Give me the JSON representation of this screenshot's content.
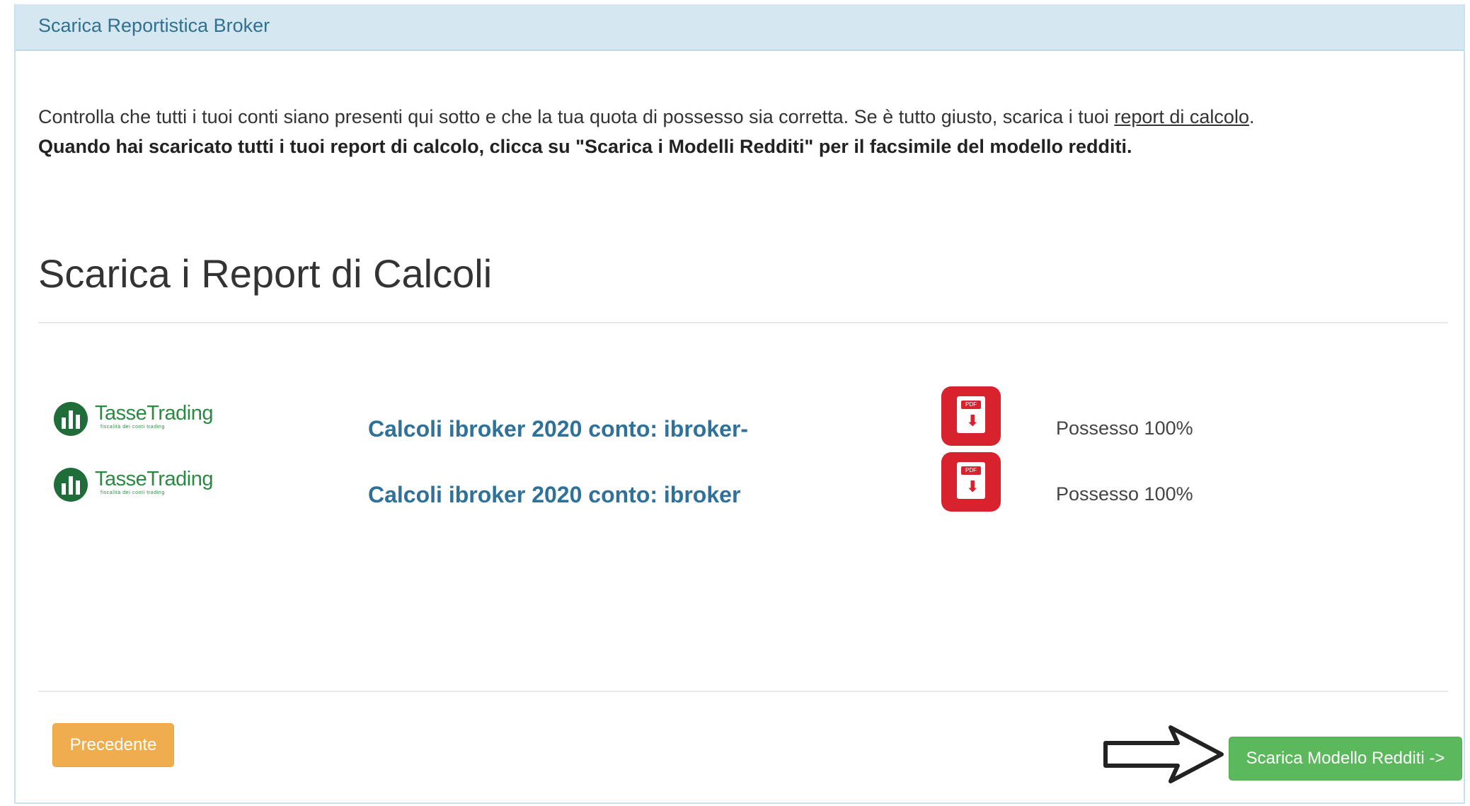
{
  "panel": {
    "title": "Scarica Reportistica Broker"
  },
  "intro": {
    "line1_text": "Controlla che tutti i tuoi conti siano presenti qui sotto e che la tua quota di possesso sia corretta. Se è tutto giusto, scarica i tuoi ",
    "line1_link": "report di calcolo",
    "line1_end": ".",
    "line2": "Quando hai scaricato tutti i tuoi report di calcolo, clicca su \"Scarica i Modelli Redditi\" per il facsimile del modello redditi."
  },
  "section": {
    "title": "Scarica i Report di Calcoli"
  },
  "brand": {
    "name": "TasseTrading",
    "tagline": "fiscalità dei conti trading",
    "color": "#2a8a42"
  },
  "reports": [
    {
      "label": "Calcoli ibroker 2020 conto: ibroker-",
      "pdf_icon": "pdf-download-icon",
      "pdf_badge": "PDF",
      "ownership": "Possesso 100%"
    },
    {
      "label": "Calcoli ibroker 2020 conto: ibroker",
      "pdf_icon": "pdf-download-icon",
      "pdf_badge": "PDF",
      "ownership": "Possesso 100%"
    }
  ],
  "buttons": {
    "prev": "Precedente",
    "next": "Scarica Modello Redditi ->"
  },
  "colors": {
    "header_bg": "#d5e8f2",
    "link": "#2f7199",
    "prev_btn": "#f0ad4e",
    "next_btn": "#5cb85c",
    "pdf_red": "#d8222d"
  }
}
